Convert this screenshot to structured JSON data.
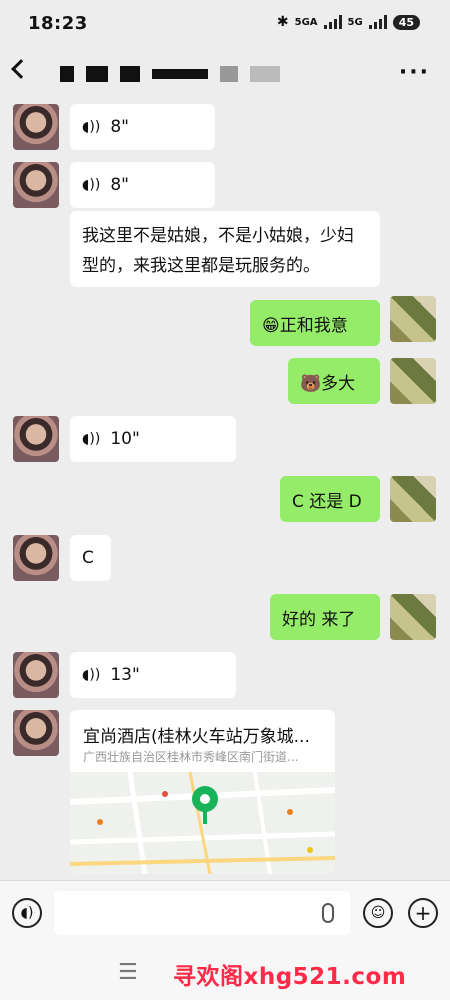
{
  "status": {
    "time": "18:23",
    "network1": "5GA",
    "network2": "5G",
    "battery": "45"
  },
  "header": {
    "title_masked": true
  },
  "messages": [
    {
      "side": "left",
      "type": "voice",
      "text": "8\""
    },
    {
      "side": "left",
      "type": "voice",
      "text": "8\""
    },
    {
      "side": "left",
      "type": "text",
      "text": "我这里不是姑娘，不是小姑娘，少妇型的，来我这里都是玩服务的。"
    },
    {
      "side": "right",
      "type": "text",
      "text": "😁正和我意"
    },
    {
      "side": "right",
      "type": "text",
      "text": "🐻多大"
    },
    {
      "side": "left",
      "type": "voice",
      "text": "10\""
    },
    {
      "side": "right",
      "type": "text",
      "text": "C 还是 D"
    },
    {
      "side": "left",
      "type": "text",
      "text": "C"
    },
    {
      "side": "right",
      "type": "text",
      "text": "好的 来了"
    },
    {
      "side": "left",
      "type": "voice",
      "text": "13\""
    }
  ],
  "location_card": {
    "title": "宜尚酒店(桂林火车站万象城...",
    "address": "广西壮族自治区桂林市秀峰区南门街道..."
  },
  "input": {
    "placeholder": ""
  },
  "watermark": "寻欢阁xhg521.com",
  "icons": {
    "voice": "voice-wave-icon",
    "emoji": "smile-icon",
    "plus": "plus-icon",
    "mic": "microphone-icon",
    "more": "more-icon",
    "back": "back-icon"
  }
}
